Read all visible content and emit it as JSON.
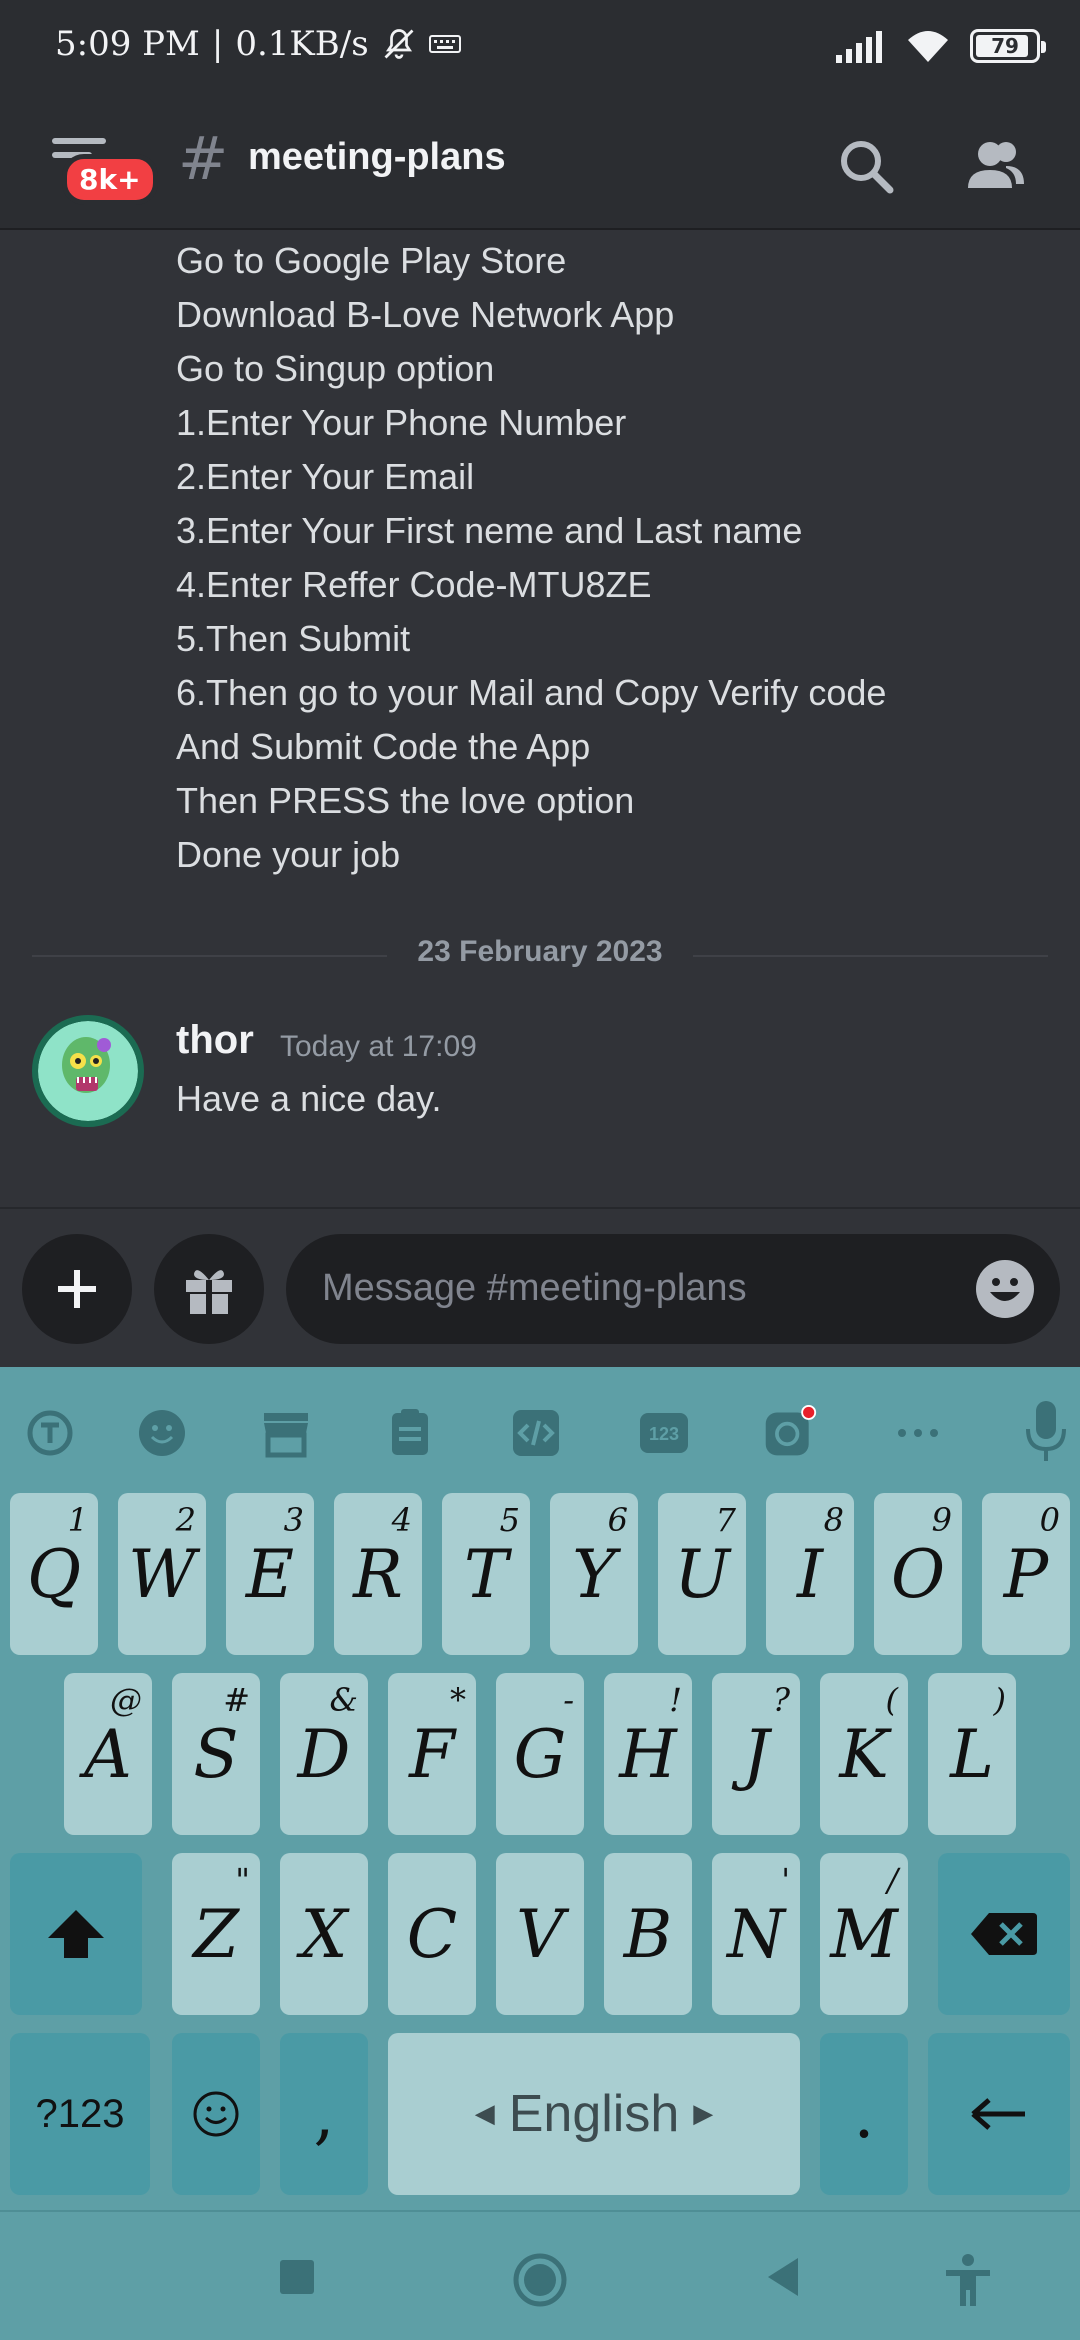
{
  "status": {
    "time": "5:09 PM",
    "speed": "0.1KB/s",
    "battery": "79"
  },
  "header": {
    "badge": "8k+",
    "hash": "#",
    "channel": "meeting-plans"
  },
  "messages": {
    "lines": [
      "Go to Google Play Store",
      "Download B-Love Network App",
      "Go to Singup option",
      "1.Enter Your Phone Number",
      "2.Enter Your Email",
      "3.Enter Your First neme and Last name",
      "4.Enter Reffer Code-MTU8ZE",
      "5.Then Submit",
      "6.Then go to your Mail and Copy Verify code",
      "And Submit Code the App",
      "Then PRESS the love option",
      "Done your job"
    ],
    "date_divider": "23 February 2023",
    "last": {
      "author": "thor",
      "timestamp": "Today at 17:09",
      "body": "Have a nice day."
    }
  },
  "composer": {
    "placeholder": "Message #meeting-plans"
  },
  "keyboard": {
    "row1": [
      {
        "k": "Q",
        "s": "1"
      },
      {
        "k": "W",
        "s": "2"
      },
      {
        "k": "E",
        "s": "3"
      },
      {
        "k": "R",
        "s": "4"
      },
      {
        "k": "T",
        "s": "5"
      },
      {
        "k": "Y",
        "s": "6"
      },
      {
        "k": "U",
        "s": "7"
      },
      {
        "k": "I",
        "s": "8"
      },
      {
        "k": "O",
        "s": "9"
      },
      {
        "k": "P",
        "s": "0"
      }
    ],
    "row2": [
      {
        "k": "A",
        "s": "@"
      },
      {
        "k": "S",
        "s": "#"
      },
      {
        "k": "D",
        "s": "&"
      },
      {
        "k": "F",
        "s": "*"
      },
      {
        "k": "G",
        "s": "-"
      },
      {
        "k": "H",
        "s": "!"
      },
      {
        "k": "J",
        "s": "?"
      },
      {
        "k": "K",
        "s": "("
      },
      {
        "k": "L",
        "s": ")"
      }
    ],
    "row3": [
      {
        "k": "Z",
        "s": "\""
      },
      {
        "k": "X",
        "s": ""
      },
      {
        "k": "C",
        "s": ""
      },
      {
        "k": "V",
        "s": ""
      },
      {
        "k": "B",
        "s": ""
      },
      {
        "k": "N",
        "s": "'"
      },
      {
        "k": "M",
        "s": ":"
      }
    ],
    "m_sup2": "/",
    "symbols_label": "?123",
    "comma": ",",
    "space_label": "English",
    "period": "."
  },
  "colors": {
    "background": "#313338",
    "header": "#2b2d31",
    "badge": "#f23f43",
    "keyboard": "#5e9fa6",
    "key": "#a9ced1"
  }
}
